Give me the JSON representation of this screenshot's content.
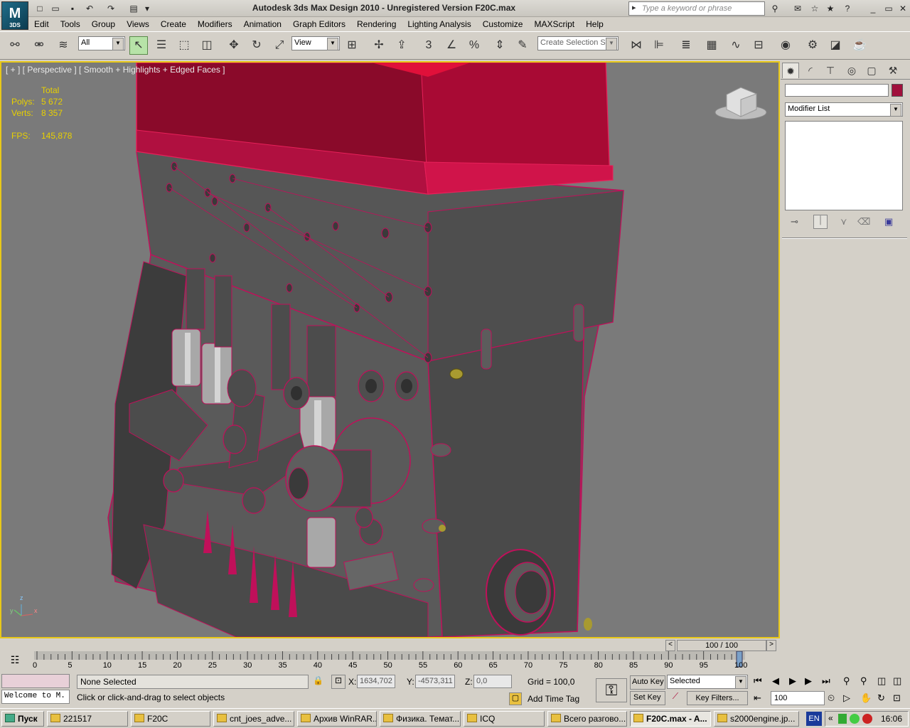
{
  "window": {
    "title": "Autodesk 3ds Max Design 2010  - Unregistered Version     F20C.max",
    "logo_text": "3DS",
    "search_placeholder": "Type a keyword or phrase"
  },
  "menu": [
    "Edit",
    "Tools",
    "Group",
    "Views",
    "Create",
    "Modifiers",
    "Animation",
    "Graph Editors",
    "Rendering",
    "Lighting Analysis",
    "Customize",
    "MAXScript",
    "Help"
  ],
  "toolbar": {
    "selection_filter": "All",
    "ref_coord": "View",
    "named_selection_placeholder": "Create Selection Se",
    "snap_label": "3"
  },
  "viewport": {
    "label": "[ + ] [ Perspective ] [ Smooth + Highlights + Edged Faces ]",
    "stats": {
      "header": "Total",
      "polys_label": "Polys:",
      "polys_value": "5 672",
      "verts_label": "Verts:",
      "verts_value": "8 357",
      "fps_label": "FPS:",
      "fps_value": "145,878"
    },
    "axis": {
      "z": "z",
      "y": "y",
      "x": "x"
    }
  },
  "command_panel": {
    "modifier_list": "Modifier List",
    "object_color": "#a0103c"
  },
  "timeline": {
    "slider_label": "100 / 100",
    "ticks": [
      "0",
      "5",
      "10",
      "15",
      "20",
      "25",
      "30",
      "35",
      "40",
      "45",
      "50",
      "55",
      "60",
      "65",
      "70",
      "75",
      "80",
      "85",
      "90",
      "95",
      "100"
    ]
  },
  "status": {
    "selection": "None Selected",
    "prompt": "Click or click-and-drag to select objects",
    "welcome": "Welcome to M.",
    "x_label": "X:",
    "x_value": "1634,702",
    "y_label": "Y:",
    "y_value": "-4573,311",
    "z_label": "Z:",
    "z_value": "0,0",
    "grid": "Grid = 100,0",
    "add_time_tag": "Add Time Tag",
    "auto_key": "Auto Key",
    "set_key": "Set Key",
    "key_mode": "Selected",
    "key_filters": "Key Filters...",
    "frame": "100"
  },
  "taskbar": {
    "start": "Пуск",
    "tasks": [
      "221517",
      "F20C",
      "cnt_joes_adve...",
      "Архив WinRAR...",
      "Физика. Темат...",
      "ICQ",
      "Всего разгово...",
      "F20C.max - A...",
      "s2000engine.jp..."
    ],
    "lang": "EN",
    "clock": "16:06"
  }
}
